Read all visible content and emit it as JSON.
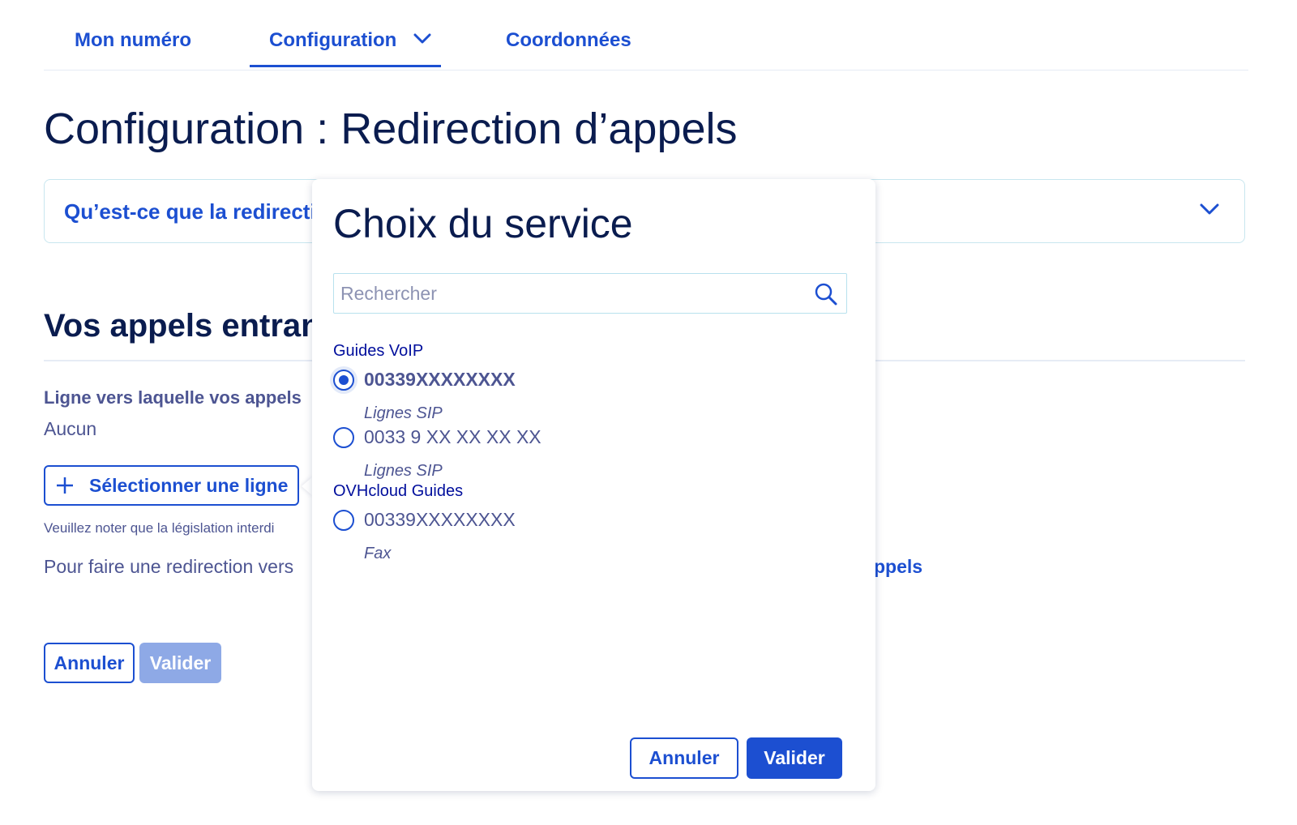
{
  "tabs": {
    "items": [
      {
        "label": "Mon numéro"
      },
      {
        "label": "Configuration"
      },
      {
        "label": "Coordonnées"
      }
    ],
    "active": "Configuration"
  },
  "page": {
    "title": "Configuration : Redirection d’appels"
  },
  "accordion": {
    "label": "Qu’est-ce que la redirecti"
  },
  "section": {
    "title": "Vos appels entran",
    "line_label": "Ligne vers laquelle vos appels",
    "line_value": "Aucun",
    "select_line_button": "Sélectionner une ligne",
    "notice": "Veuillez noter que la législation interdi",
    "redirect_text": "Pour faire une redirection vers",
    "redirect_link": "ppels",
    "cancel_button": "Annuler",
    "validate_button": "Valider"
  },
  "modal": {
    "title": "Choix du service",
    "search_placeholder": "Rechercher",
    "groups": [
      {
        "label": "Guides VoIP",
        "options": [
          {
            "number": "00339XXXXXXXX",
            "type": "Lignes SIP",
            "selected": true
          },
          {
            "number": "0033 9 XX XX XX XX",
            "type": "Lignes SIP",
            "selected": false
          }
        ]
      },
      {
        "label": "OVHcloud Guides",
        "options": [
          {
            "number": "00339XXXXXXXX",
            "type": "Fax",
            "selected": false
          }
        ]
      }
    ],
    "cancel_button": "Annuler",
    "validate_button": "Valider"
  },
  "colors": {
    "primary": "#1c4fd1",
    "heading": "#0a1c4f",
    "text": "#4d5592",
    "disabled_button": "#8ea9e6",
    "border": "#c8e6ef"
  }
}
